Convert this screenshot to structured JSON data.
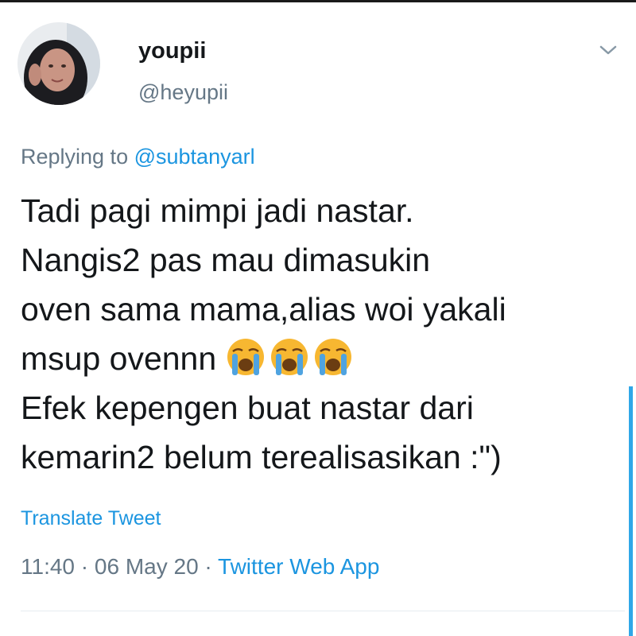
{
  "tweet": {
    "user": {
      "display_name": "youpii",
      "handle": "@heyupii"
    },
    "reply_context": {
      "prefix": "Replying to",
      "mention": "@subtanyarl"
    },
    "text_lines": [
      "Tadi pagi mimpi jadi nastar.",
      "Nangis2 pas mau dimasukin",
      "oven sama mama,alias woi yakali",
      "msup ovennn",
      "Efek kepengen buat nastar dari",
      "kemarin2 belum terealisasikan :\")"
    ],
    "emoji": [
      "loudly-crying-face",
      "loudly-crying-face",
      "loudly-crying-face"
    ],
    "translate_label": "Translate Tweet",
    "timestamp": {
      "time": "11:40",
      "separator": "·",
      "date": "06 May 20",
      "source": "Twitter Web App"
    }
  },
  "colors": {
    "text": "#14171a",
    "secondary": "#657786",
    "link": "#1b95e0",
    "scrollbar": "#2fa7e8"
  }
}
